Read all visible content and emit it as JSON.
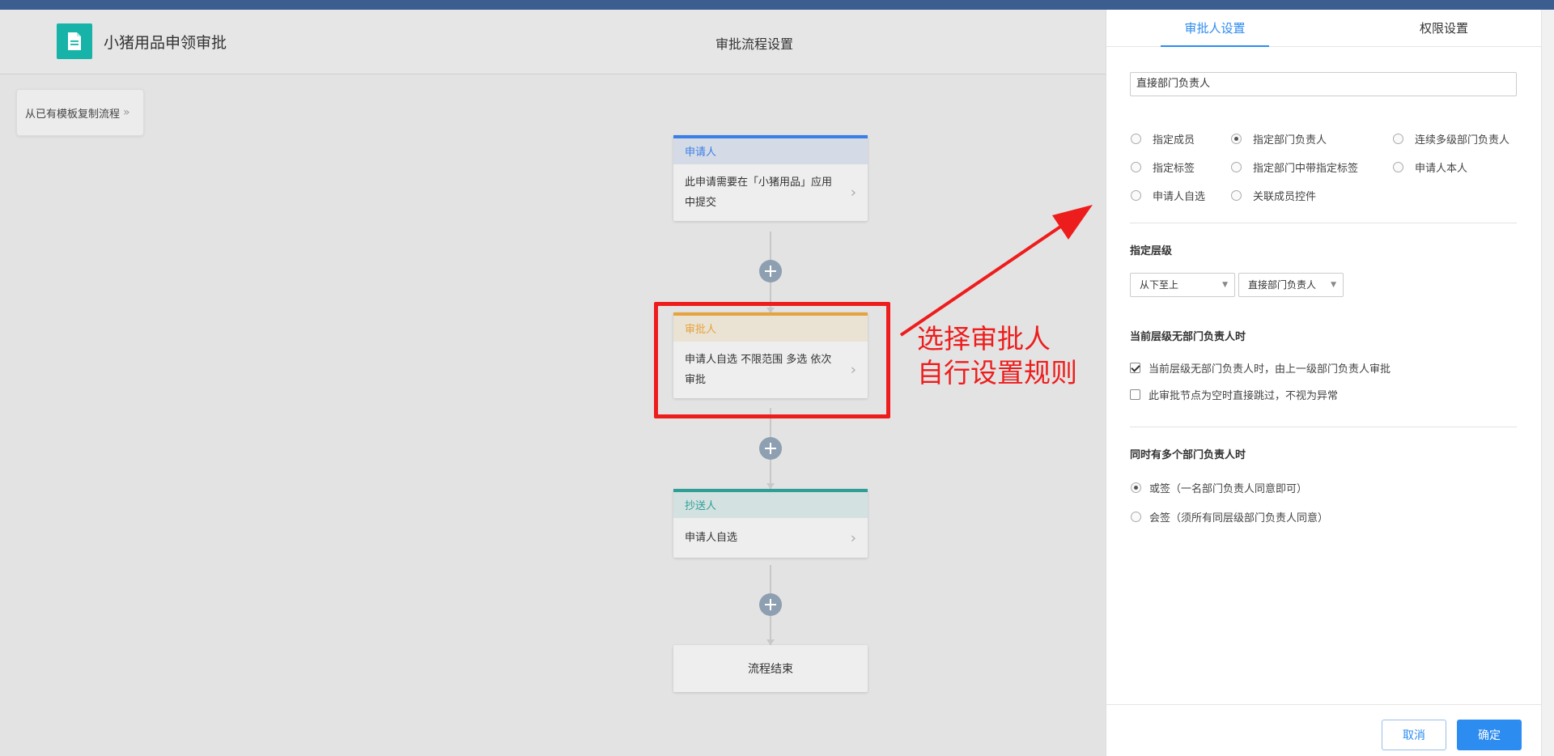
{
  "header": {
    "app_title": "小猪用品申领审批",
    "page_title": "审批流程设置"
  },
  "copy_template_label": "从已有模板复制流程",
  "flow": {
    "applicant": {
      "title": "申请人",
      "desc": "此申请需要在「小猪用品」应用中提交"
    },
    "approver": {
      "title": "审批人",
      "desc": "申请人自选 不限范围 多选 依次审批"
    },
    "cc": {
      "title": "抄送人",
      "desc": "申请人自选"
    },
    "end": "流程结束"
  },
  "annotation": {
    "line1": "选择审批人",
    "line2": "自行设置规则"
  },
  "panel": {
    "tabs": [
      "审批人设置",
      "权限设置"
    ],
    "selected_type": "直接部门负责人",
    "approver_types": [
      {
        "label": "指定成员",
        "checked": false
      },
      {
        "label": "指定部门负责人",
        "checked": true
      },
      {
        "label": "连续多级部门负责人",
        "checked": false
      },
      {
        "label": "指定标签",
        "checked": false
      },
      {
        "label": "指定部门中带指定标签",
        "checked": false
      },
      {
        "label": "申请人本人",
        "checked": false
      },
      {
        "label": "申请人自选",
        "checked": false
      },
      {
        "label": "关联成员控件",
        "checked": false
      }
    ],
    "level_section": {
      "title": "指定层级",
      "direction": "从下至上",
      "level": "直接部门负责人"
    },
    "no_head_section": {
      "title": "当前层级无部门负责人时",
      "options": [
        {
          "label": "当前层级无部门负责人时，由上一级部门负责人审批",
          "checked": true
        },
        {
          "label": "此审批节点为空时直接跳过，不视为异常",
          "checked": false
        }
      ]
    },
    "multi_head_section": {
      "title": "同时有多个部门负责人时",
      "options": [
        {
          "label": "或签（一名部门负责人同意即可）",
          "checked": true
        },
        {
          "label": "会签（须所有同层级部门负责人同意）",
          "checked": false
        }
      ]
    },
    "cancel_label": "取消",
    "ok_label": "确定"
  },
  "colors": {
    "accent": "#2d8cf0",
    "applicant": "#3a7ee8",
    "approver": "#e6a23c",
    "cc": "#2f9e96",
    "annotation": "#ee1d1d",
    "app_icon": "#18b3a8"
  }
}
